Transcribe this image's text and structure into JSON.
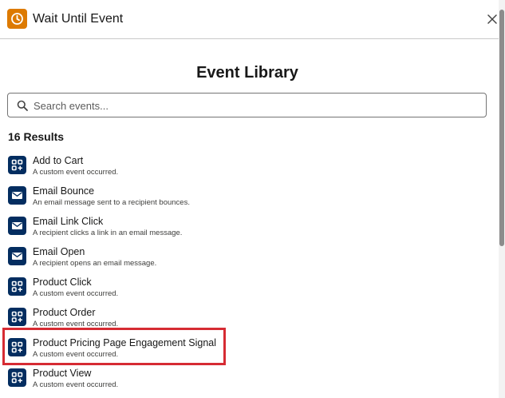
{
  "header": {
    "title": "Wait Until Event",
    "icon": "clock-icon",
    "accent_color": "#dd7a01"
  },
  "library": {
    "title": "Event Library"
  },
  "search": {
    "placeholder": "Search events...",
    "value": ""
  },
  "results": {
    "count_label": "16 Results"
  },
  "events": [
    {
      "name": "Add to Cart",
      "description": "A custom event occurred.",
      "icon": "custom-event-icon"
    },
    {
      "name": "Email Bounce",
      "description": "An email message sent to a recipient bounces.",
      "icon": "email-icon"
    },
    {
      "name": "Email Link Click",
      "description": "A recipient clicks a link in an email message.",
      "icon": "email-icon"
    },
    {
      "name": "Email Open",
      "description": "A recipient opens an email message.",
      "icon": "email-icon"
    },
    {
      "name": "Product Click",
      "description": "A custom event occurred.",
      "icon": "custom-event-icon"
    },
    {
      "name": "Product Order",
      "description": "A custom event occurred.",
      "icon": "custom-event-icon"
    },
    {
      "name": "Product Pricing Page Engagement Signal",
      "description": "A custom event occurred.",
      "icon": "custom-event-icon"
    },
    {
      "name": "Product View",
      "description": "A custom event occurred.",
      "icon": "custom-event-icon"
    }
  ],
  "colors": {
    "event_icon_bg": "#032d60",
    "highlight": "#d62b33"
  }
}
